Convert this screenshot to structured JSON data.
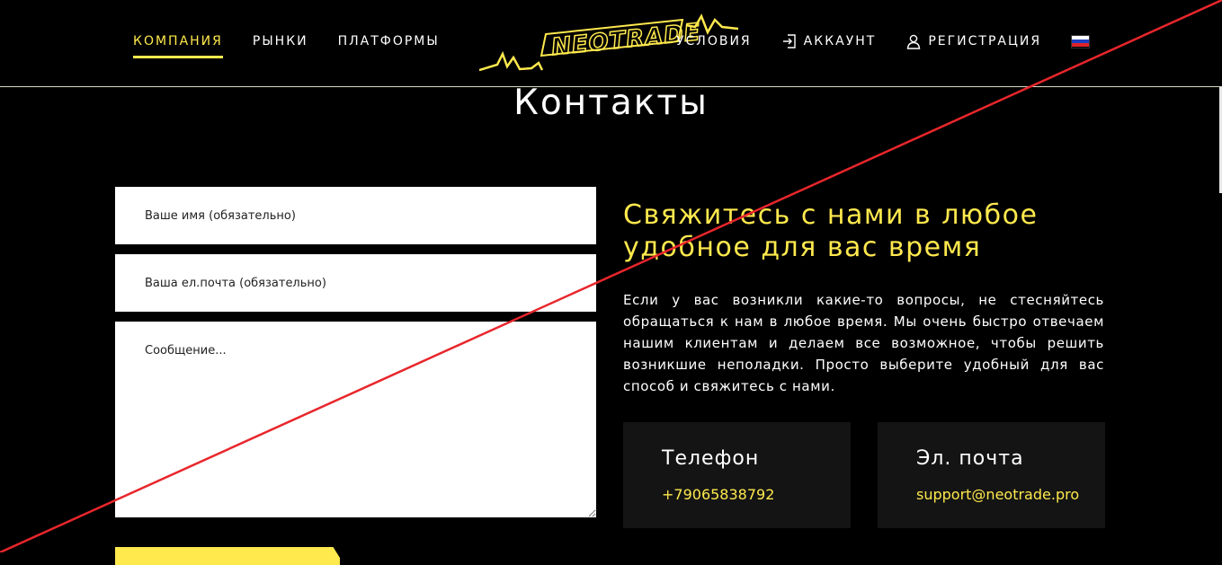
{
  "header": {
    "nav_left": [
      {
        "label": "КОМПАНИЯ",
        "active": true
      },
      {
        "label": "РЫНКИ"
      },
      {
        "label": "ПЛАТФОРМЫ"
      }
    ],
    "nav_right": {
      "terms": "УСЛОВИЯ",
      "account": "АККАУНТ",
      "register": "РЕГИСТРАЦИЯ"
    },
    "logo_text": "NEOTRADE",
    "language_flag": "ru-flag-icon"
  },
  "page_title": "Контакты",
  "form": {
    "name_placeholder": "Ваше имя (обязательно)",
    "email_placeholder": "Ваша ел.почта (обязательно)",
    "message_placeholder": "Сообщение..."
  },
  "contact": {
    "title": "Свяжитесь с нами в любое удобное для вас время",
    "text": "Если у вас возникли какие-то вопросы, не стесняйтесь обращаться к нам в любое время. Мы очень быстро отвечаем нашим клиентам и делаем все возможное, чтобы решить возникшие неполадки. Просто выберите удобный для вас способ и свяжитесь с нами.",
    "phone_title": "Телефон",
    "phone_value": "+79065838792",
    "email_title": "Эл. почта",
    "email_value": "support@neotrade.pro"
  },
  "colors": {
    "accent": "#ffe94d",
    "background": "#000000",
    "card": "#141414",
    "strike_line": "#e8262c"
  }
}
